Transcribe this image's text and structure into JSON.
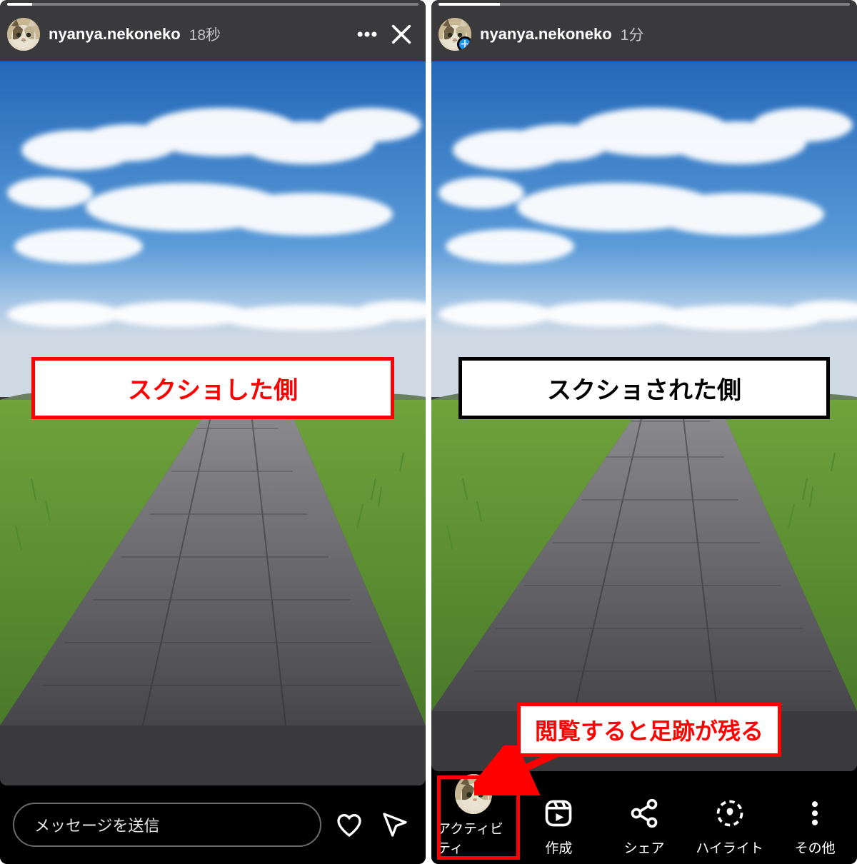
{
  "left": {
    "username": "nyanya.nekoneko",
    "time_label": "18秒",
    "reply_placeholder": "メッセージを送信",
    "progress_percent": 6,
    "callout_main": "スクショした側"
  },
  "right": {
    "username": "nyanya.nekoneko",
    "time_label": "1分",
    "progress_percent": 15,
    "callout_main": "スクショされた側",
    "callout_sub": "閲覧すると足跡が残る",
    "actions": {
      "activity": "アクティビティ",
      "create": "作成",
      "share": "シェア",
      "highlight": "ハイライト",
      "more": "その他"
    }
  }
}
